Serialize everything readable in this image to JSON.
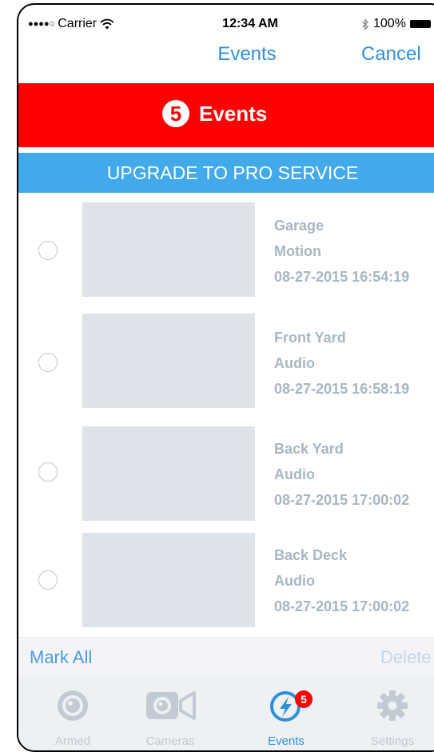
{
  "status_bar": {
    "carrier": "Carrier",
    "time": "12:34 AM",
    "battery": "100%"
  },
  "nav": {
    "title": "Events",
    "cancel_label": "Cancel"
  },
  "banner": {
    "count": "5",
    "title": "Events"
  },
  "upgrade_label": "UPGRADE TO PRO SERVICE",
  "events": [
    {
      "camera": "Garage",
      "type": "Motion",
      "timestamp": "08-27-2015 16:54:19"
    },
    {
      "camera": "Front Yard",
      "type": "Audio",
      "timestamp": "08-27-2015 16:58:19"
    },
    {
      "camera": "Back Yard",
      "type": "Audio",
      "timestamp": "08-27-2015 17:00:02"
    },
    {
      "camera": "Back Deck",
      "type": "Audio",
      "timestamp": "08-27-2015 17:00:02"
    }
  ],
  "actions": {
    "mark_all_label": "Mark All",
    "delete_label": "Delete"
  },
  "tabs": [
    {
      "label": "Armed",
      "icon": "armed-icon"
    },
    {
      "label": "Cameras",
      "icon": "camera-icon"
    },
    {
      "label": "Events",
      "icon": "events-icon",
      "badge": "5",
      "active": true
    },
    {
      "label": "Settings",
      "icon": "gear-icon"
    }
  ],
  "colors": {
    "accent": "#2f8fd8",
    "banner": "#ff0000",
    "upgrade": "#42a9ea",
    "event_text": "#a7b6c4"
  }
}
